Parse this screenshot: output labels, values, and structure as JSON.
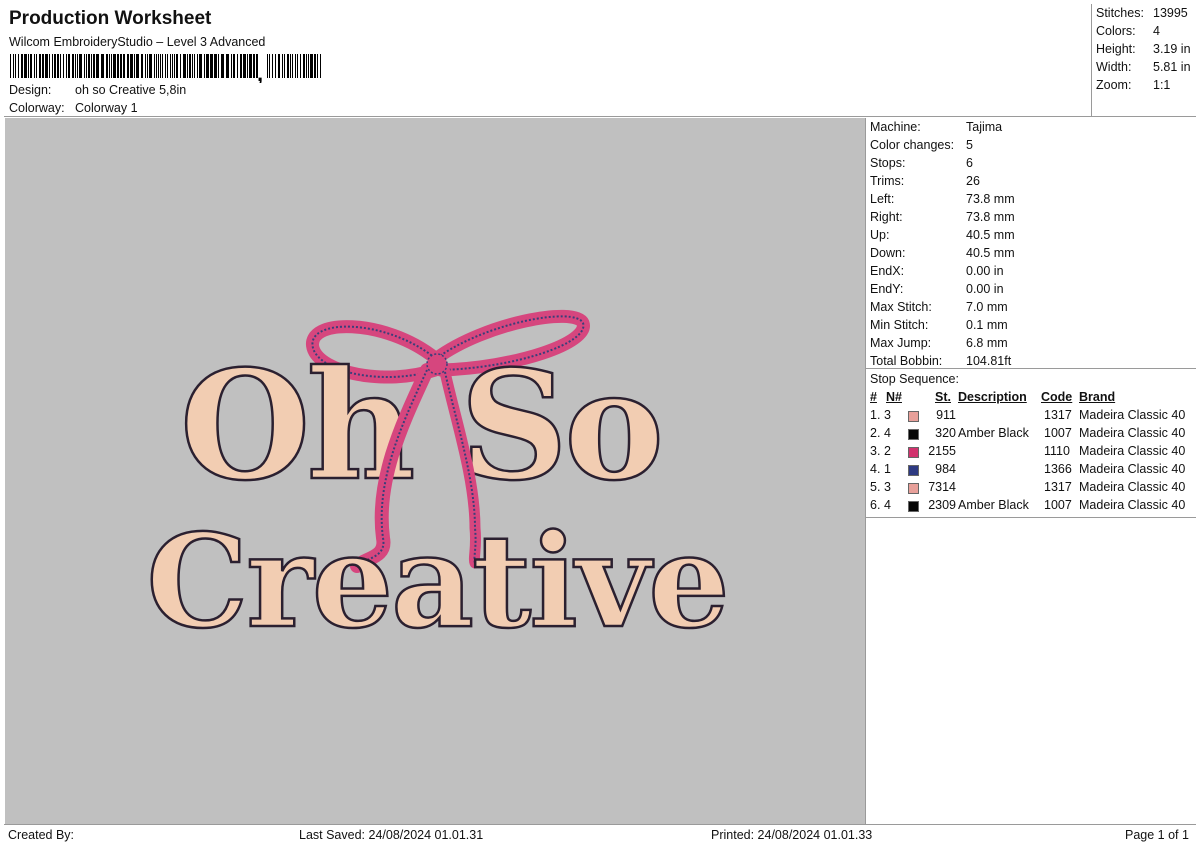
{
  "header": {
    "title": "Production Worksheet",
    "subtitle": "Wilcom EmbroideryStudio – Level 3 Advanced",
    "design_label": "Design:",
    "design_value": "oh so Creative 5,8in",
    "colorway_label": "Colorway:",
    "colorway_value": "Colorway 1"
  },
  "summary": [
    {
      "label": "Stitches:",
      "value": "13995"
    },
    {
      "label": "Colors:",
      "value": "4"
    },
    {
      "label": "Height:",
      "value": "3.19 in"
    },
    {
      "label": "Width:",
      "value": "5.81 in"
    },
    {
      "label": "Zoom:",
      "value": "1:1"
    }
  ],
  "machine_info": [
    {
      "label": "Machine:",
      "value": "Tajima"
    },
    {
      "label": "Color changes:",
      "value": "5"
    },
    {
      "label": "Stops:",
      "value": "6"
    },
    {
      "label": "Trims:",
      "value": "26"
    },
    {
      "label": "Left:",
      "value": "73.8 mm"
    },
    {
      "label": "Right:",
      "value": "73.8 mm"
    },
    {
      "label": "Up:",
      "value": "40.5 mm"
    },
    {
      "label": "Down:",
      "value": "40.5 mm"
    },
    {
      "label": "EndX:",
      "value": "0.00 in"
    },
    {
      "label": "EndY:",
      "value": "0.00 in"
    },
    {
      "label": "Max Stitch:",
      "value": "7.0 mm"
    },
    {
      "label": "Min Stitch:",
      "value": "0.1 mm"
    },
    {
      "label": "Max Jump:",
      "value": "6.8 mm"
    },
    {
      "label": "Total Bobbin:",
      "value": "104.81ft"
    }
  ],
  "stop_sequence": {
    "title": "Stop Sequence:",
    "headers": {
      "num": "#",
      "n": "N#",
      "st": "St.",
      "description": "Description",
      "code": "Code",
      "brand": "Brand"
    },
    "rows": [
      {
        "num": "1.",
        "n": "3",
        "color": "#e8a09a",
        "st": "911",
        "description": "",
        "code": "1317",
        "brand": "Madeira Classic 40"
      },
      {
        "num": "2.",
        "n": "4",
        "color": "#050505",
        "st": "320",
        "description": "Amber Black",
        "code": "1007",
        "brand": "Madeira Classic 40"
      },
      {
        "num": "3.",
        "n": "2",
        "color": "#d1336e",
        "st": "2155",
        "description": "",
        "code": "1110",
        "brand": "Madeira Classic 40"
      },
      {
        "num": "4.",
        "n": "1",
        "color": "#2e3a82",
        "st": "984",
        "description": "",
        "code": "1366",
        "brand": "Madeira Classic 40"
      },
      {
        "num": "5.",
        "n": "3",
        "color": "#e8a09a",
        "st": "7314",
        "description": "",
        "code": "1317",
        "brand": "Madeira Classic 40"
      },
      {
        "num": "6.",
        "n": "4",
        "color": "#050505",
        "st": "2309",
        "description": "Amber Black",
        "code": "1007",
        "brand": "Madeira Classic 40"
      }
    ]
  },
  "design_preview": {
    "line1": "Oh So",
    "line2": "Creative",
    "fill_color": "#f2cdb2",
    "outline_color": "#2b2030",
    "ribbon_color": "#d6467e",
    "ribbon_stitch_color": "#3a3f7a",
    "background_color": "#c0c0c0"
  },
  "footer": {
    "created_by": "Created By:",
    "last_saved": "Last Saved: 24/08/2024 01.01.31",
    "printed": "Printed: 24/08/2024 01.01.33",
    "page": "Page 1 of 1"
  }
}
